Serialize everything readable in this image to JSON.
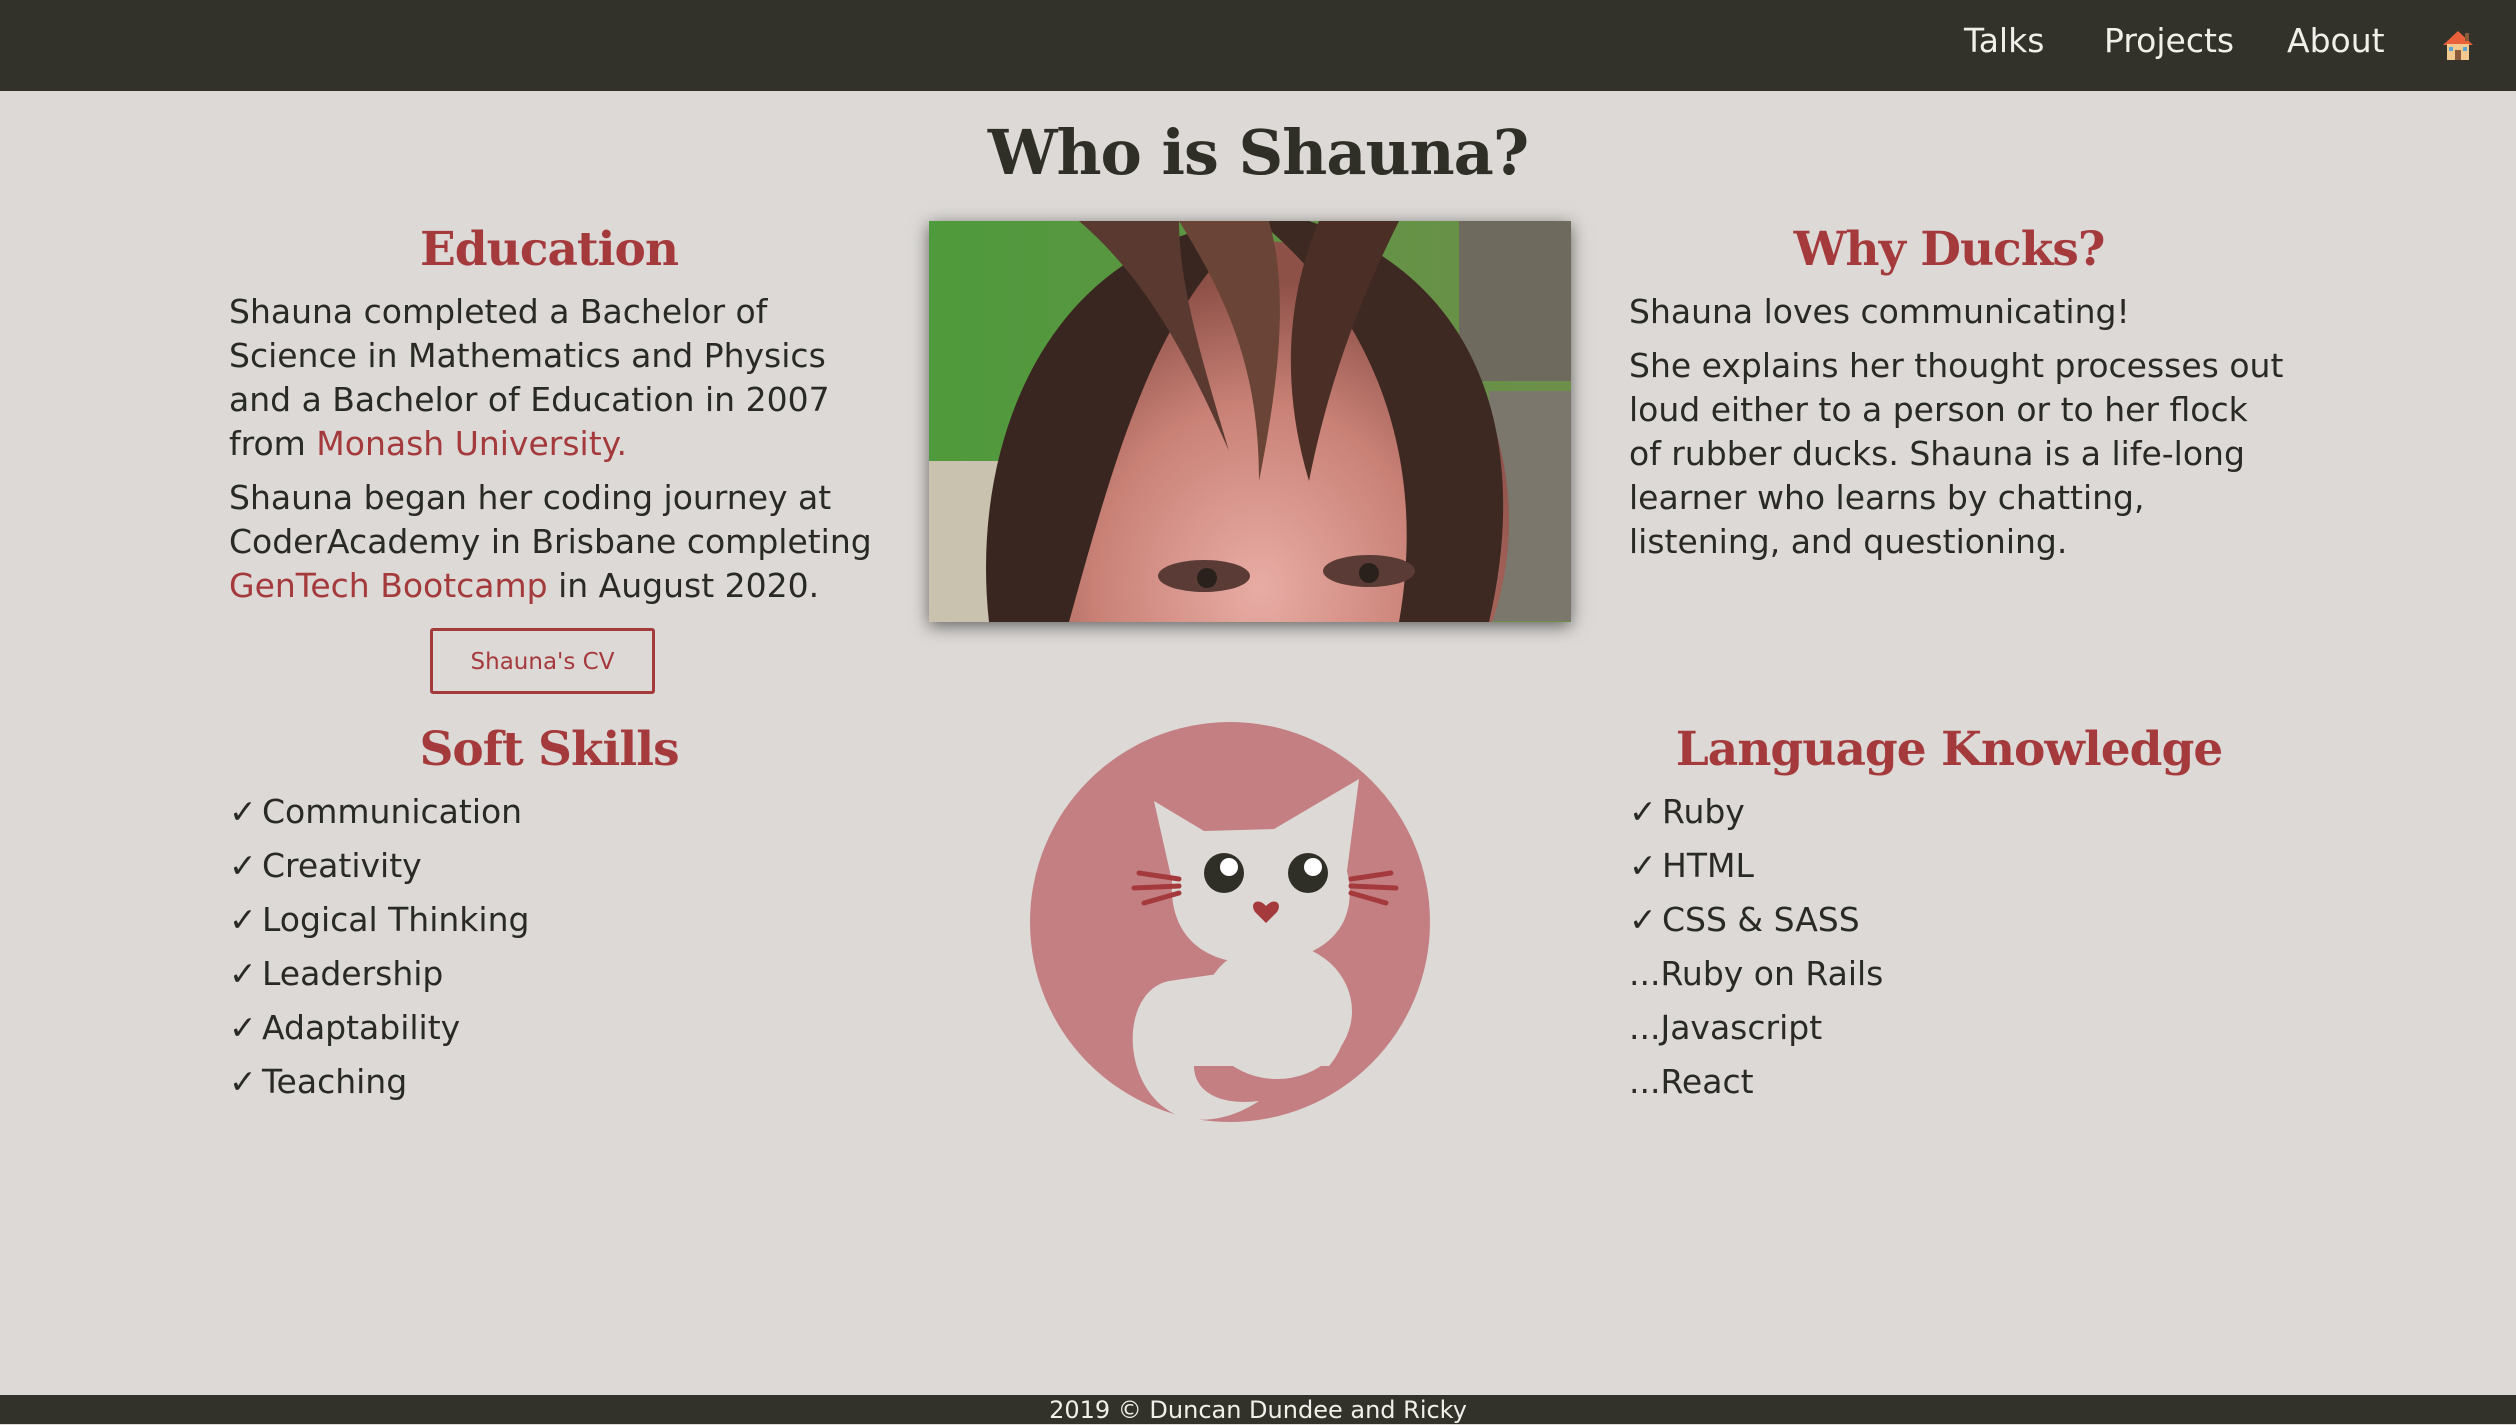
{
  "nav": {
    "talks": "Talks",
    "projects": "Projects",
    "about": "About"
  },
  "page": {
    "title": "Who is Shauna?"
  },
  "education": {
    "title": "Education",
    "p1_text": "Shauna completed a Bachelor of Science in Mathematics and Physics and a Bachelor of Education in 2007 from ",
    "p1_link": "Monash University.",
    "p2_text": "Shauna began her coding journey at CoderAcademy in Brisbane completing ",
    "p2_link": "GenTech Bootcamp",
    "p2_after": " in August 2020.",
    "cv_button": "Shauna's CV"
  },
  "why_ducks": {
    "title": "Why Ducks?",
    "p1": "Shauna loves communicating!",
    "p2": "She explains her thought processes out loud either to a person or to her flock of rubber ducks. Shauna is a life-long learner who learns by chatting, listening, and questioning."
  },
  "soft_skills": {
    "title": "Soft Skills",
    "items": [
      {
        "mark": "✓",
        "label": "Communication"
      },
      {
        "mark": "✓",
        "label": "Creativity"
      },
      {
        "mark": "✓",
        "label": "Logical Thinking"
      },
      {
        "mark": "✓",
        "label": "Leadership"
      },
      {
        "mark": "✓",
        "label": "Adaptability"
      },
      {
        "mark": "✓",
        "label": "Teaching"
      }
    ]
  },
  "languages": {
    "title": "Language Knowledge",
    "items": [
      {
        "mark": "✓",
        "label": "Ruby"
      },
      {
        "mark": "✓",
        "label": "HTML"
      },
      {
        "mark": "✓",
        "label": "CSS & SASS"
      },
      {
        "mark": "",
        "label": "...Ruby on Rails"
      },
      {
        "mark": "",
        "label": "...Javascript"
      },
      {
        "mark": "",
        "label": "...React"
      }
    ]
  },
  "footer": {
    "text": "2019 © Duncan Dundee and Ricky"
  },
  "colors": {
    "background": "#dcd9d6",
    "nav_bg": "#32322b",
    "accent": "#a53a3d",
    "logo_circle": "#c47f82"
  },
  "icons": {
    "home": "home-icon",
    "profile_photo": "profile-photo",
    "logo": "cat-logo"
  }
}
